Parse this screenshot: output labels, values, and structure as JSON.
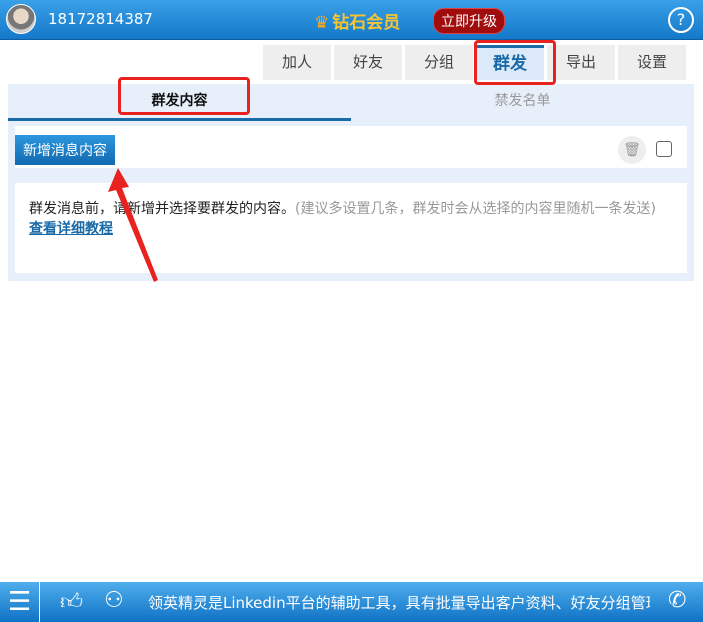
{
  "header": {
    "phone": "18172814387",
    "vip_label": "钻石会员",
    "upgrade_label": "立即升级",
    "help_label": "?"
  },
  "tabs": [
    {
      "label": "加人"
    },
    {
      "label": "好友"
    },
    {
      "label": "分组"
    },
    {
      "label": "群发"
    },
    {
      "label": "导出"
    },
    {
      "label": "设置"
    }
  ],
  "subtabs": [
    {
      "label": "群发内容"
    },
    {
      "label": "禁发名单"
    }
  ],
  "content": {
    "add_button": "新增消息内容",
    "info_main": "群发消息前，请新增并选择要群发的内容。",
    "info_hint": "(建议多设置几条，群发时会从选择的内容里随机一条发送)",
    "tutorial_link": "查看详细教程"
  },
  "footer": {
    "marquee": "领英精灵是Linkedin平台的辅助工具，具有批量导出客户资料、好友分组管理"
  }
}
